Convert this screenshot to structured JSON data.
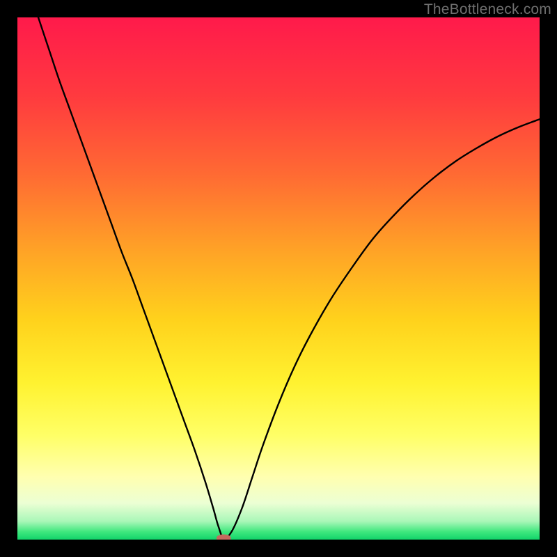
{
  "watermark": "TheBottleneck.com",
  "chart_data": {
    "type": "line",
    "title": "",
    "xlabel": "",
    "ylabel": "",
    "xlim": [
      0,
      100
    ],
    "ylim": [
      0,
      100
    ],
    "grid": false,
    "legend": false,
    "background_gradient": {
      "stops": [
        {
          "pos": 0.0,
          "color": "#ff1a4b"
        },
        {
          "pos": 0.15,
          "color": "#ff3a3f"
        },
        {
          "pos": 0.3,
          "color": "#ff6a33"
        },
        {
          "pos": 0.45,
          "color": "#ffa426"
        },
        {
          "pos": 0.58,
          "color": "#ffd21c"
        },
        {
          "pos": 0.7,
          "color": "#fff230"
        },
        {
          "pos": 0.8,
          "color": "#ffff66"
        },
        {
          "pos": 0.88,
          "color": "#ffffb0"
        },
        {
          "pos": 0.93,
          "color": "#ecffd4"
        },
        {
          "pos": 0.965,
          "color": "#a9f7b8"
        },
        {
          "pos": 0.985,
          "color": "#3fe87e"
        },
        {
          "pos": 1.0,
          "color": "#12d46a"
        }
      ]
    },
    "series": [
      {
        "name": "bottleneck-curve",
        "color": "#000000",
        "x": [
          4,
          6,
          8,
          10,
          12,
          14,
          16,
          18,
          20,
          22,
          24,
          26,
          28,
          30,
          32,
          34,
          36,
          37.5,
          38.5,
          39.5,
          41,
          43,
          45,
          47,
          50,
          53,
          56,
          60,
          64,
          68,
          72,
          76,
          80,
          84,
          88,
          92,
          96,
          100
        ],
        "y": [
          100,
          94,
          88,
          82.5,
          77,
          71.5,
          66,
          60.5,
          55,
          50,
          44.5,
          39,
          33.5,
          28,
          22.5,
          17,
          11,
          6,
          2.5,
          0.3,
          1.5,
          6,
          12,
          18,
          26,
          33,
          39,
          46,
          52,
          57.5,
          62,
          66,
          69.5,
          72.5,
          75,
          77.2,
          79,
          80.5
        ]
      }
    ],
    "marker": {
      "name": "minimum-marker",
      "x": 39.5,
      "y": 0.3,
      "rx": 1.4,
      "ry": 0.7,
      "color": "#c5695e"
    }
  }
}
